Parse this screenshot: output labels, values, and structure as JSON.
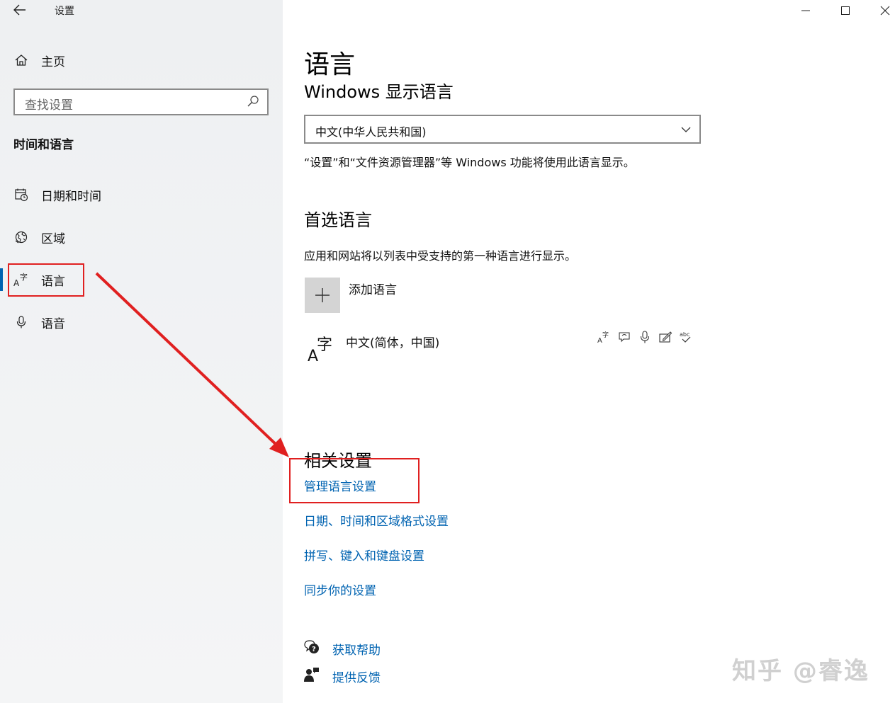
{
  "window": {
    "title": "设置",
    "controls": [
      "minimize",
      "maximize",
      "close"
    ]
  },
  "sidebar": {
    "home_label": "主页",
    "search_placeholder": "查找设置",
    "section_title": "时间和语言",
    "items": [
      {
        "label": "日期和时间",
        "icon": "calendar-clock-icon"
      },
      {
        "label": "区域",
        "icon": "globe-region-icon"
      },
      {
        "label": "语言",
        "icon": "language-icon",
        "active": true
      },
      {
        "label": "语音",
        "icon": "microphone-icon"
      }
    ]
  },
  "main": {
    "title": "语言",
    "display_language_heading": "Windows 显示语言",
    "display_language_value": "中文(中华人民共和国)",
    "display_language_note": "“设置”和“文件资源管理器”等 Windows 功能将使用此语言显示。",
    "preferred_heading": "首选语言",
    "preferred_note": "应用和网站将以列表中受支持的第一种语言进行显示。",
    "add_language_label": "添加语言",
    "languages": [
      {
        "name": "中文(简体，中国)",
        "features": [
          "display-language-icon",
          "speech-bubble-icon",
          "microphone-icon",
          "handwriting-icon",
          "spellcheck-icon"
        ]
      }
    ],
    "related_heading": "相关设置",
    "related_links": [
      "管理语言设置",
      "日期、时间和区域格式设置",
      "拼写、键入和键盘设置",
      "同步你的设置"
    ],
    "help_links": [
      {
        "label": "获取帮助",
        "icon": "help-chat-icon"
      },
      {
        "label": "提供反馈",
        "icon": "feedback-icon"
      }
    ]
  },
  "watermark": "知乎 @睿逸",
  "colors": {
    "accent": "#0063b1",
    "annotation": "#e02020",
    "sidebar_bg": "#f1f2f3"
  }
}
